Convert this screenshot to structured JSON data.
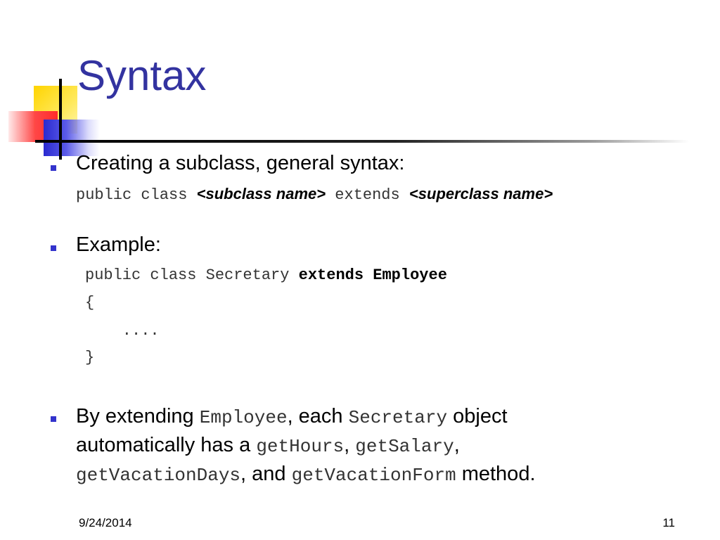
{
  "slide": {
    "title": "Syntax",
    "bullet1": {
      "text": "Creating a subclass, general syntax:",
      "syntax_public_class": "public class ",
      "syntax_subclass": "<subclass name>",
      "syntax_extends": " extends ",
      "syntax_superclass": "<superclass name>"
    },
    "bullet2": {
      "text": "Example:",
      "code_line1_prefix": "public class Secretary ",
      "code_line1_bold": "extends Employee",
      "code_line2": "{",
      "code_line3": "    ....",
      "code_line4": "}"
    },
    "bullet3": {
      "part1": "By extending ",
      "code1": "Employee",
      "part2": ", each ",
      "code2": "Secretary",
      "part3": " object",
      "part4": "automatically has a ",
      "code3": "getHours",
      "part5": ", ",
      "code4": "getSalary",
      "part6": ",",
      "code5": "getVacationDays",
      "part7": ", and ",
      "code6": "getVacationForm",
      "part8": " method."
    }
  },
  "footer": {
    "date": "9/24/2014",
    "page_number": "11"
  },
  "colors": {
    "title": "#3333a0",
    "bullet": "#3333cc"
  }
}
